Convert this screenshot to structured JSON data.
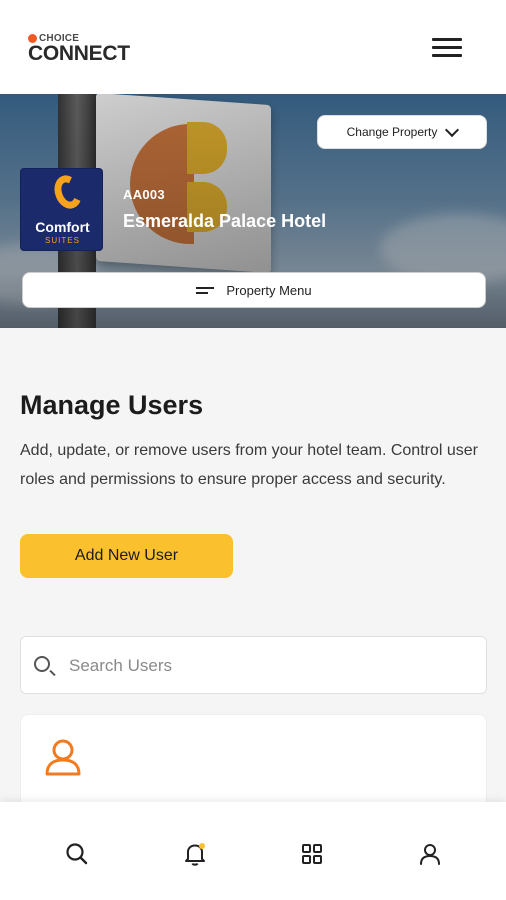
{
  "header": {
    "logo_small": "CHOICE",
    "logo_big": "CONNECT"
  },
  "hero": {
    "change_property_label": "Change Property",
    "brand": {
      "word": "Comfort",
      "sub": "SUITES"
    },
    "property_code": "AA003",
    "property_name": "Esmeralda Palace Hotel",
    "property_menu_label": "Property Menu"
  },
  "main": {
    "title": "Manage Users",
    "description": "Add, update, or remove users from your hotel team. Control user roles and permissions to ensure proper access and security.",
    "add_button_label": "Add New User",
    "search_placeholder": "Search Users"
  },
  "colors": {
    "accent": "#fbc02d",
    "user_icon": "#f47a20",
    "brand_navy": "#1b2a6b"
  },
  "bottom_nav": [
    {
      "icon": "search-icon"
    },
    {
      "icon": "bell-icon"
    },
    {
      "icon": "grid-icon"
    },
    {
      "icon": "profile-icon"
    }
  ]
}
